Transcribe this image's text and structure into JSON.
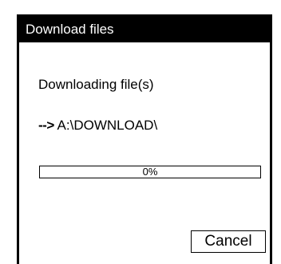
{
  "dialog": {
    "title": "Download files",
    "status_text": "Downloading file(s)",
    "path_arrow": "-->",
    "path": "A:\\DOWNLOAD\\",
    "progress": {
      "percent": 0,
      "label": "0%"
    },
    "cancel_label": "Cancel"
  }
}
